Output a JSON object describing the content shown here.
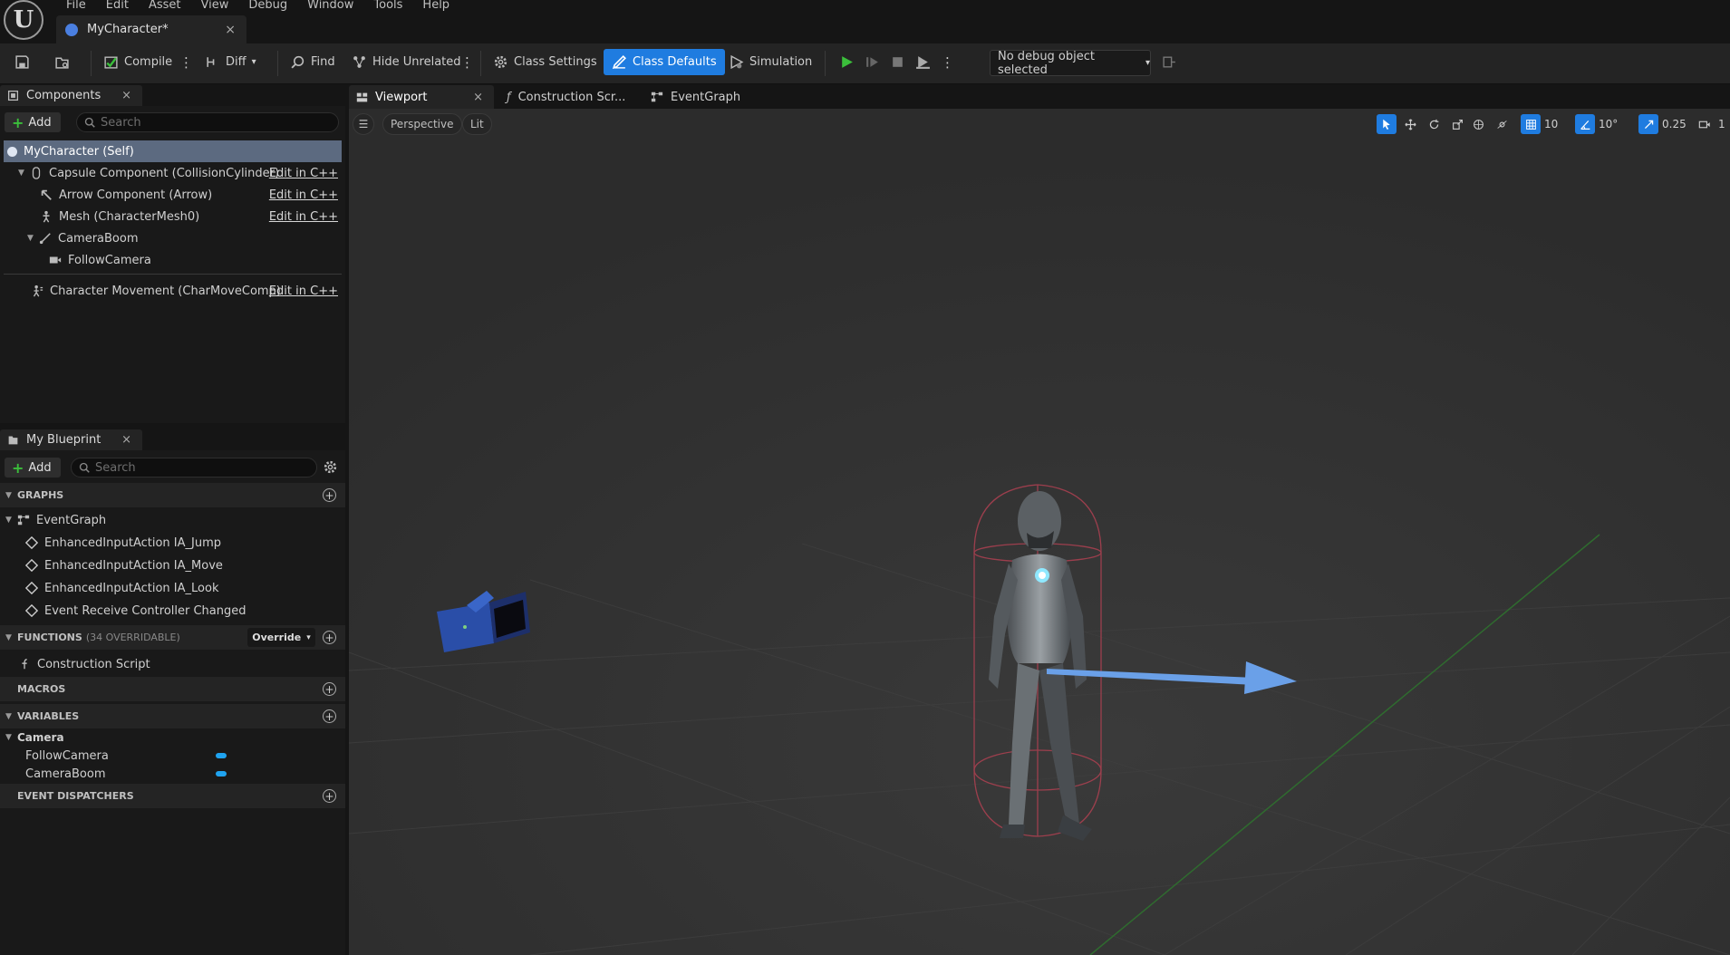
{
  "app": {
    "logo_glyph": "U"
  },
  "menu": [
    "File",
    "Edit",
    "Asset",
    "View",
    "Debug",
    "Window",
    "Tools",
    "Help"
  ],
  "document_tab": {
    "label": "MyCharacter*",
    "close": "×"
  },
  "toolbar": {
    "compile": "Compile",
    "diff": "Diff",
    "find": "Find",
    "hide_unrelated": "Hide Unrelated",
    "class_settings": "Class Settings",
    "class_defaults": "Class Defaults",
    "simulation": "Simulation",
    "debug_object": "No debug object selected"
  },
  "components_panel": {
    "title": "Components",
    "add": "Add",
    "search_placeholder": "Search",
    "items": [
      {
        "label": "MyCharacter (Self)"
      },
      {
        "label": "Capsule Component (CollisionCylinder)",
        "action": "Edit in C++"
      },
      {
        "label": "Arrow Component (Arrow)",
        "action": "Edit in C++"
      },
      {
        "label": "Mesh (CharacterMesh0)",
        "action": "Edit in C++"
      },
      {
        "label": "CameraBoom"
      },
      {
        "label": "FollowCamera"
      },
      {
        "label": "Character Movement (CharMoveComp)",
        "action": "Edit in C++"
      }
    ]
  },
  "my_blueprint": {
    "title": "My Blueprint",
    "add": "Add",
    "search_placeholder": "Search",
    "graphs_header": "GRAPHS",
    "event_graph": "EventGraph",
    "graph_items": [
      "EnhancedInputAction IA_Jump",
      "EnhancedInputAction IA_Move",
      "EnhancedInputAction IA_Look",
      "Event Receive Controller Changed"
    ],
    "functions_header": "FUNCTIONS",
    "functions_note": "(34 OVERRIDABLE)",
    "override": "Override",
    "construction_script": "Construction Script",
    "macros_header": "MACROS",
    "variables_header": "VARIABLES",
    "variable_category": "Camera",
    "variables": [
      "FollowCamera",
      "CameraBoom"
    ],
    "dispatchers_header": "EVENT DISPATCHERS",
    "variable_color": "#1fa3f0"
  },
  "viewport_tabs": [
    "Viewport",
    "Construction Scr...",
    "EventGraph"
  ],
  "viewport": {
    "view_mode": "Perspective",
    "lighting": "Lit",
    "grid_snap": "10",
    "rotation_snap": "10°",
    "scale_snap": "0.25",
    "camera_speed": "1"
  },
  "colors": {
    "accent": "#1f7ce0",
    "compile_ok": "#3bbf3b",
    "play": "#3bbf3b"
  }
}
